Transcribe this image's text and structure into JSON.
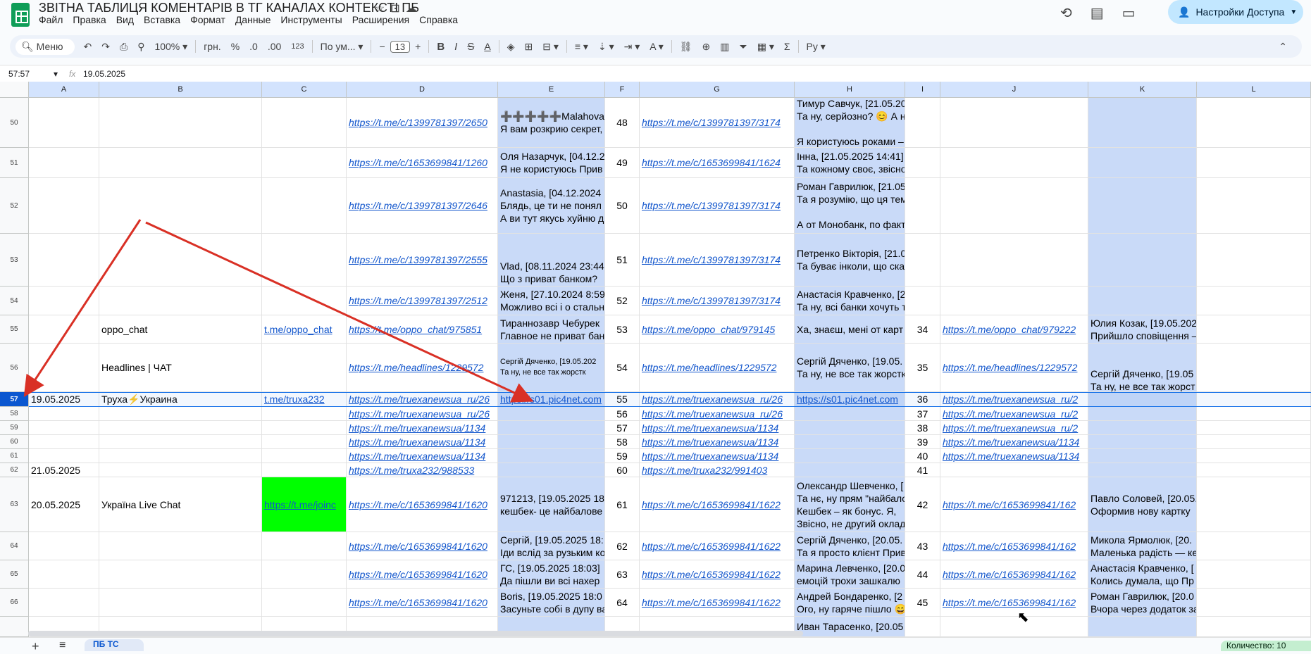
{
  "app": {
    "title": "ЗВІТНА ТАБЛИЦЯ КОМЕНТАРІВ В ТГ КАНАЛАХ КОНТЕКСТІ ПБ",
    "menu": [
      "Файл",
      "Правка",
      "Вид",
      "Вставка",
      "Формат",
      "Данные",
      "Инструменты",
      "Расширения",
      "Справка"
    ],
    "share_label": "Настройки Доступа"
  },
  "toolbar": {
    "search": "Меню",
    "zoom": "100%",
    "currency": "грн.",
    "percent": "%",
    "dec_less": ".0",
    "dec_more": ".00",
    "number_fmt": "123",
    "font": "По ум...",
    "font_size": "13"
  },
  "formula_bar": {
    "cell_ref": "57:57",
    "fx": "fx",
    "value": "19.05.2025"
  },
  "columns": [
    "A",
    "B",
    "C",
    "D",
    "E",
    "F",
    "G",
    "H",
    "I",
    "J",
    "K",
    "L"
  ],
  "rows": [
    {
      "num": "50",
      "A": "",
      "B": "",
      "C": "",
      "D": "https://t.me/c/1399781397/2650",
      "E": "➕➕➕➕➕Malahova➕\nЯ вам розкрию секрет,",
      "F": "48",
      "G": "https://t.me/c/1399781397/3174",
      "H": "Тимур Савчук, [21.05.20\nТа ну, серйозно? 😊 А н\n\nЯ користуюсь роками –",
      "I": "",
      "J": "",
      "K": ""
    },
    {
      "num": "51",
      "A": "",
      "B": "",
      "C": "",
      "D": "https://t.me/c/1653699841/1260",
      "E": "Оля Назарчук, [04.12.2\nЯ не користуюсь Прив",
      "F": "49",
      "G": "https://t.me/c/1653699841/1624",
      "H": "Інна, [21.05.2025 14:41]\nТа кожному своє, звісно",
      "I": "",
      "J": "",
      "K": ""
    },
    {
      "num": "52",
      "A": "",
      "B": "",
      "C": "",
      "D": "https://t.me/c/1399781397/2646",
      "E": "Anastasia, [04.12.2024\nБлядь, це ти не понял\nА ви тут якусь хуйню д",
      "F": "50",
      "G": "https://t.me/c/1399781397/3174",
      "H": "Роман Гаврилюк, [21.05\nТа я розумію, що ця тем\n\nА от Монобанк, по факт",
      "I": "",
      "J": "",
      "K": ""
    },
    {
      "num": "53",
      "A": "",
      "B": "",
      "C": "",
      "D": "https://t.me/c/1399781397/2555",
      "E": "\n\nVlad, [08.11.2024 23:44\nЩо з приват банком?",
      "F": "51",
      "G": "https://t.me/c/1399781397/3174",
      "H": "Петренко Вікторія, [21.0\nТа буває інколи, що ска",
      "I": "",
      "J": "",
      "K": ""
    },
    {
      "num": "54",
      "A": "",
      "B": "",
      "C": "",
      "D": "https://t.me/c/1399781397/2512",
      "E": "Женя, [27.10.2024 8:59\nМожливо всі і о стальн",
      "F": "52",
      "G": "https://t.me/c/1399781397/3174",
      "H": "Анастасія Кравченко, [2\nТа ну, всі банки хочуть т",
      "I": "",
      "J": "",
      "K": ""
    },
    {
      "num": "55",
      "A": "",
      "B": "oppo_chat",
      "C": "t.me/oppo_chat",
      "D": "https://t.me/oppo_chat/975851",
      "E": "Тираннозавр Чебурек\nГлавное не приват бан",
      "F": "53",
      "G": "https://t.me/oppo_chat/979145",
      "H": "Ха, знаєш, мені от карт",
      "I": "34",
      "J": "https://t.me/oppo_chat/979222",
      "K": "Юлия Козак, [19.05.202\nПрийшло сповіщення –"
    },
    {
      "num": "56",
      "A": "",
      "B": "Headlines | ЧАТ",
      "C": "",
      "D": "https://t.me/headlines/1229572",
      "E": "Сергій Дяченко, [19.05.202\nТа ну, не все так жорстк",
      "F": "54",
      "G": "https://t.me/headlines/1229572",
      "H": "Сергій Дяченко, [19.05.\nТа ну, не все так жорстк",
      "I": "35",
      "J": "https://t.me/headlines/1229572",
      "K": "\n\nСергій Дяченко, [19.05\nТа ну, не все так жорст"
    },
    {
      "num": "57",
      "A": "19.05.2025",
      "B": "Труха⚡Украина",
      "C": "t.me/truxa232",
      "D": "https://t.me/truexanewsua_ru/26",
      "E": "https://s01.pic4net.com",
      "F": "55",
      "G": "https://t.me/truexanewsua_ru/26",
      "H": "https://s01.pic4net.com",
      "I": "36",
      "J": "https://t.me/truexanewsua_ru/2",
      "K": ""
    },
    {
      "num": "58",
      "A": "",
      "B": "",
      "C": "",
      "D": "https://t.me/truexanewsua_ru/26",
      "E": "",
      "F": "56",
      "G": "https://t.me/truexanewsua_ru/26",
      "H": "",
      "I": "37",
      "J": "https://t.me/truexanewsua_ru/2",
      "K": ""
    },
    {
      "num": "59",
      "A": "",
      "B": "",
      "C": "",
      "D": "https://t.me/truexanewsua/1134",
      "E": "",
      "F": "57",
      "G": "https://t.me/truexanewsua/1134",
      "H": "",
      "I": "38",
      "J": "https://t.me/truexanewsua_ru/2",
      "K": ""
    },
    {
      "num": "60",
      "A": "",
      "B": "",
      "C": "",
      "D": "https://t.me/truexanewsua/1134",
      "E": "",
      "F": "58",
      "G": "https://t.me/truexanewsua/1134",
      "H": "",
      "I": "39",
      "J": "https://t.me/truexanewsua/1134",
      "K": ""
    },
    {
      "num": "61",
      "A": "",
      "B": "",
      "C": "",
      "D": "https://t.me/truexanewsua/1134",
      "E": "",
      "F": "59",
      "G": "https://t.me/truexanewsua/1134",
      "H": "",
      "I": "40",
      "J": "https://t.me/truexanewsua/1134",
      "K": ""
    },
    {
      "num": "62",
      "A": "21.05.2025",
      "B": "",
      "C": "",
      "D": "https://t.me/truxa232/988533",
      "E": "",
      "F": "60",
      "G": "https://t.me/truxa232/991403",
      "H": "",
      "I": "41",
      "J": "",
      "K": ""
    },
    {
      "num": "63",
      "A": "20.05.2025",
      "B": "Україна Live Chat",
      "C": "https://t.me/joinc",
      "D": "https://t.me/c/1653699841/1620",
      "E": "971213, [19.05.2025 18\nкешбек- це найбалове",
      "F": "61",
      "G": "https://t.me/c/1653699841/1622",
      "H": "Олександр Шевченко, [\nТа нє, ну прям \"найбало\nКешбек – як бонус. Я,\nЗвісно, не другий оклад",
      "I": "42",
      "J": "https://t.me/c/1653699841/162",
      "K": "Павло Соловей, [20.05.\nОформив нову картку"
    },
    {
      "num": "64",
      "A": "",
      "B": "",
      "C": "",
      "D": "https://t.me/c/1653699841/1620",
      "E": "Сергій, [19.05.2025 18:\nІди вслід за рузьким ко",
      "F": "62",
      "G": "https://t.me/c/1653699841/1622",
      "H": "Сергій Дяченко, [20.05.\nТа я просто клієнт Прив",
      "I": "43",
      "J": "https://t.me/c/1653699841/162",
      "K": "Микола Ярмолюк, [20.\nМаленька радість — ке"
    },
    {
      "num": "65",
      "A": "",
      "B": "",
      "C": "",
      "D": "https://t.me/c/1653699841/1620",
      "E": "ГС, [19.05.2025 18:03]\nДа пішли ви всі нахер",
      "F": "63",
      "G": "https://t.me/c/1653699841/1622",
      "H": "Марина Левченко, [20.0\nемоцій трохи зашкалю",
      "I": "44",
      "J": "https://t.me/c/1653699841/162",
      "K": "Анастасія Кравченко, [\nКолись думала, що Пр"
    },
    {
      "num": "66",
      "A": "",
      "B": "",
      "C": "",
      "D": "https://t.me/c/1653699841/1620",
      "E": "Boris, [19.05.2025 18:0\nЗасуньте собі в дупу ва",
      "F": "64",
      "G": "https://t.me/c/1653699841/1622",
      "H": "Андрей Бондаренко, [2\nОго, ну гаряче пішло 😄",
      "I": "45",
      "J": "https://t.me/c/1653699841/162",
      "K": "Роман Гаврилюк, [20.0\nВчора через додаток за"
    },
    {
      "num": "",
      "A": "",
      "B": "",
      "C": "",
      "D": "",
      "E": "",
      "F": "",
      "G": "",
      "H": "Иван Тарасенко, [20.05",
      "I": "",
      "J": "",
      "K": ""
    }
  ],
  "bottom": {
    "sheet_tab": "ПБ ТС",
    "count_label": "Количество: 10"
  },
  "colors": {
    "accent": "#0b57d0",
    "highlight_col": "#c9daf8",
    "green_cell": "#00ff00",
    "arrow": "#d93025"
  }
}
